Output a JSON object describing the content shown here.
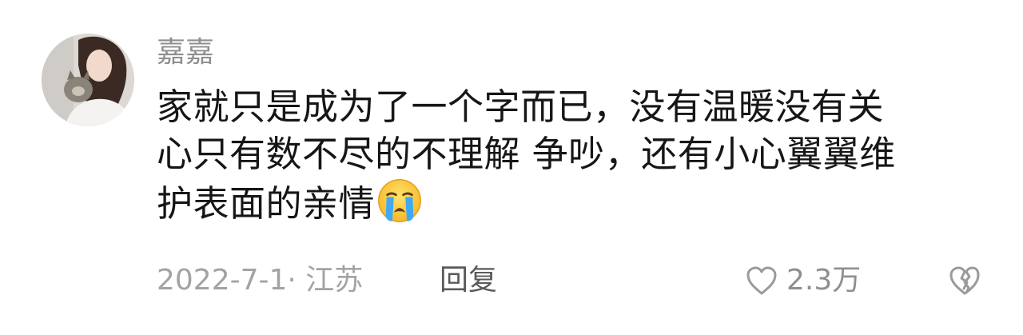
{
  "comment": {
    "username": "嘉嘉",
    "content_lines": [
      "家就只是成为了一个字而已，没有温暖没有关",
      "心只有数不尽的不理解 争吵，还有小心翼翼维",
      "护表面的亲情"
    ],
    "emoji": "loudly-crying-face",
    "meta": {
      "date_location": "2022-7-1· 江苏",
      "reply_label": "回复"
    },
    "likes": {
      "count": "2.3万",
      "icon": "heart-outline-icon"
    },
    "dislike": {
      "icon": "broken-heart-outline-icon"
    }
  }
}
